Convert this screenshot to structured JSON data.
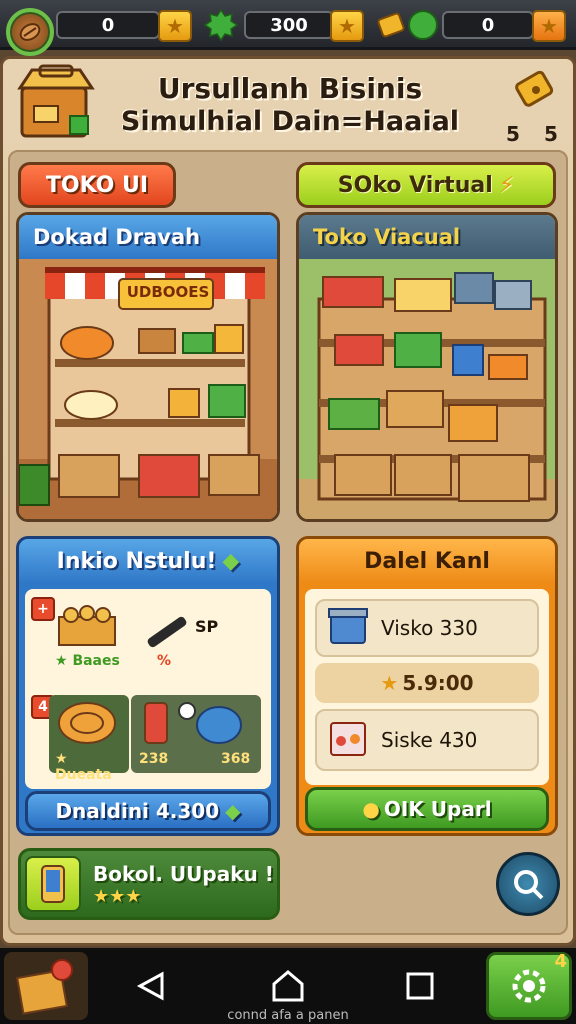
{
  "topbar": {
    "resource_1_value": "0",
    "resource_2_value": "300",
    "resource_3_value": "0"
  },
  "header": {
    "title_line_1": "Ursullanh Bisinis",
    "title_line_2": "Simulhial Dain=Haaial",
    "count_left": "5",
    "count_right": "5"
  },
  "tabs": {
    "left_label": "TOKO UI",
    "right_label": "SOko Virtual"
  },
  "cards": {
    "physical_store_title": "Dokad Dravah",
    "virtual_store_title": "Toko Viacual",
    "awning_sign": "UDBOOES",
    "inventory_title": "Inkio Nstulu!",
    "deal_title": "Dalel Kanl"
  },
  "inventory": {
    "item_1_label": "Baaes",
    "item_2_label": "SP",
    "item_2_percent": "%",
    "item_3_label": "Dueata",
    "item_4_label": "238",
    "item_5_label": "368",
    "badge_1": "+",
    "badge_2": "4",
    "total_button": "Dnaldini 4.300"
  },
  "deal": {
    "row_1_label": "Visko 330",
    "price_label": "5.9:00",
    "row_2_label": "Siske 430",
    "upgrade_button": "OIK Uparl"
  },
  "promo": {
    "label": "Bokol. UUpaku !",
    "stars": "★★★"
  },
  "navbar": {
    "caption": "connd afa a panen"
  },
  "colors": {
    "accent_green": "#3f9a22",
    "accent_blue": "#2f78c8",
    "accent_orange": "#ee8b16",
    "accent_red": "#e2461f"
  }
}
